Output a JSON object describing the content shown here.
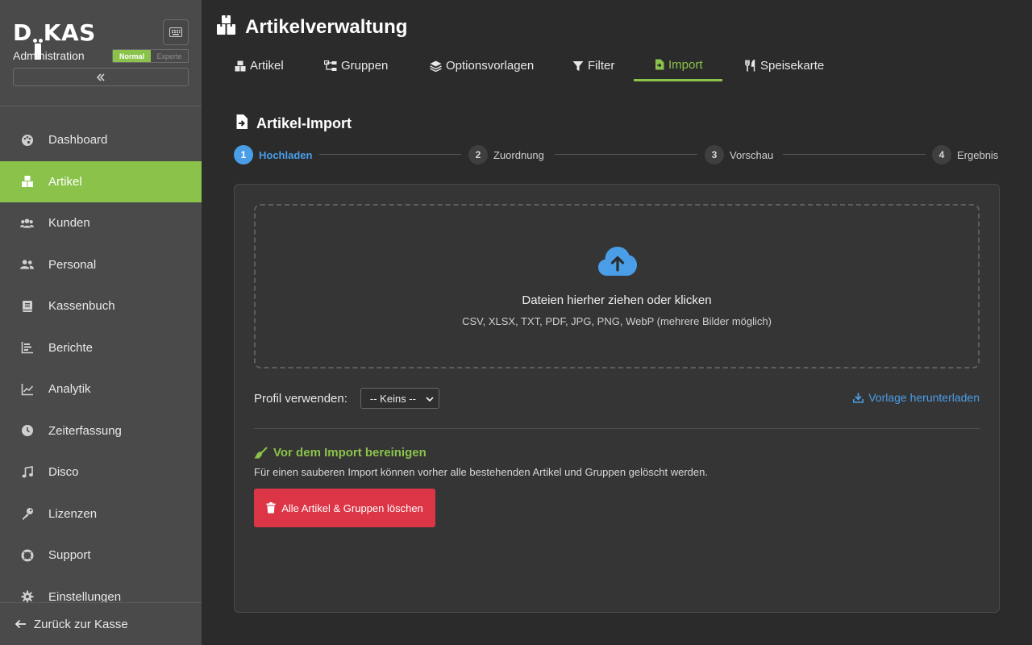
{
  "sidebar": {
    "logo": "DKAS",
    "subtitle": "Administration",
    "mode_normal": "Normal",
    "mode_expert": "Experte",
    "items": [
      {
        "label": "Dashboard",
        "icon": "palette-icon"
      },
      {
        "label": "Artikel",
        "icon": "boxes-icon",
        "active": true
      },
      {
        "label": "Kunden",
        "icon": "users-icon"
      },
      {
        "label": "Personal",
        "icon": "user-group-icon"
      },
      {
        "label": "Kassenbuch",
        "icon": "book-icon"
      },
      {
        "label": "Berichte",
        "icon": "bar-chart-icon"
      },
      {
        "label": "Analytik",
        "icon": "line-chart-icon"
      },
      {
        "label": "Zeiterfassung",
        "icon": "clock-icon"
      },
      {
        "label": "Disco",
        "icon": "music-icon"
      },
      {
        "label": "Lizenzen",
        "icon": "key-icon"
      },
      {
        "label": "Support",
        "icon": "lifebuoy-icon"
      },
      {
        "label": "Einstellungen",
        "icon": "gear-icon"
      }
    ],
    "back_label": "Zurück zur Kasse"
  },
  "header": {
    "title": "Artikelverwaltung"
  },
  "tabs": [
    {
      "label": "Artikel",
      "icon": "boxes-icon"
    },
    {
      "label": "Gruppen",
      "icon": "sitemap-icon"
    },
    {
      "label": "Optionsvorlagen",
      "icon": "layers-icon"
    },
    {
      "label": "Filter",
      "icon": "filter-icon"
    },
    {
      "label": "Import",
      "icon": "file-import-icon",
      "active": true
    },
    {
      "label": "Speisekarte",
      "icon": "utensils-icon"
    }
  ],
  "import": {
    "title": "Artikel-Import",
    "steps": [
      {
        "num": "1",
        "label": "Hochladen"
      },
      {
        "num": "2",
        "label": "Zuordnung"
      },
      {
        "num": "3",
        "label": "Vorschau"
      },
      {
        "num": "4",
        "label": "Ergebnis"
      }
    ],
    "dropzone_title": "Dateien hierher ziehen oder klicken",
    "dropzone_sub": "CSV, XLSX, TXT, PDF, JPG, PNG, WebP (mehrere Bilder möglich)",
    "profile_label": "Profil verwenden:",
    "profile_value": "-- Keins --",
    "download_label": "Vorlage herunterladen",
    "clean_title": "Vor dem Import bereinigen",
    "clean_desc": "Für einen sauberen Import können vorher alle bestehenden Artikel und Gruppen gelöscht werden.",
    "delete_button": "Alle Artikel & Gruppen löschen"
  },
  "colors": {
    "accent_green": "#8bc34a",
    "accent_blue": "#4a9ee8",
    "danger_red": "#dc3545"
  }
}
